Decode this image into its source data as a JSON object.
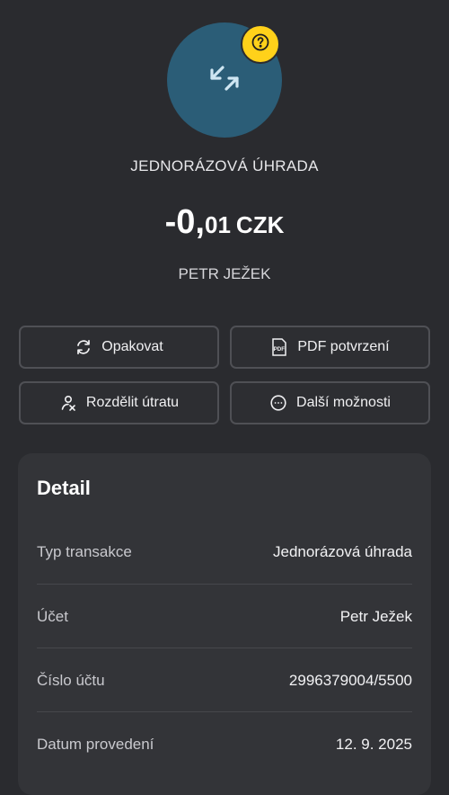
{
  "header": {
    "icon": "transfer-arrows-icon",
    "badge_icon": "question-icon",
    "badge_color": "#ffd11a",
    "avatar_color": "#2b5d77",
    "transaction_type": "JEDNORÁZOVÁ ÚHRADA",
    "amount_main": "-0,",
    "amount_decimals": "01",
    "currency": "CZK",
    "counterparty": "PETR JEŽEK"
  },
  "actions": [
    {
      "label": "Opakovat",
      "icon": "repeat-icon"
    },
    {
      "label": "PDF potvrzení",
      "icon": "pdf-icon"
    },
    {
      "label": "Rozdělit útratu",
      "icon": "split-user-icon"
    },
    {
      "label": "Další možnosti",
      "icon": "more-options-icon"
    }
  ],
  "detail": {
    "title": "Detail",
    "rows": [
      {
        "label": "Typ transakce",
        "value": "Jednorázová úhrada"
      },
      {
        "label": "Účet",
        "value": "Petr Ježek"
      },
      {
        "label": "Číslo účtu",
        "value": "2996379004/5500"
      },
      {
        "label": "Datum provedení",
        "value": "12. 9. 2025"
      }
    ]
  }
}
